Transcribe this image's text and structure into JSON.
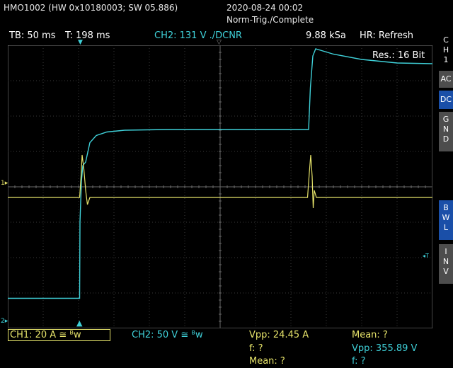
{
  "header": {
    "device": "HMO1002 (HW 0x10180003; SW 05.886)",
    "datetime": "2020-08-24 00:02",
    "mode": "Norm-Trig./Complete"
  },
  "status_bar": {
    "timebase": "TB: 50 ms",
    "trigger_time": "T: 198 ms",
    "trigger_source": "CH2: 131 V ./DCNR",
    "sample_rate": "9.88 kSa",
    "acq_mode": "HR: Refresh",
    "resolution": "Res.: 16 Bit"
  },
  "side_panel": {
    "channel": [
      "C",
      "H",
      "1"
    ],
    "ac": "AC",
    "dc": "DC",
    "gnd": [
      "G",
      "N",
      "D"
    ],
    "bwl": [
      "B",
      "W",
      "L"
    ],
    "inv": [
      "I",
      "N",
      "V"
    ]
  },
  "markers": {
    "ch1_level": "1",
    "ch2_level": "2",
    "trigger_level": "T"
  },
  "footer": {
    "ch1_scale": "CH1: 20 A ≅ ᴮw",
    "ch2_scale": "CH2: 50 V ≅ ᴮw",
    "ch1_vpp": "Vpp: 24.45 A",
    "ch1_f": "f: ?",
    "ch1_mean": "Mean: ?",
    "ch2_mean": "Mean: ?",
    "ch2_vpp": "Vpp: 355.89 V",
    "ch2_f": "f: ?"
  },
  "colors": {
    "ch1": "#e6e36a",
    "ch2": "#3fd1d9",
    "grid": "#3a3a3a",
    "panel_active": "#1a4fa8",
    "panel_inactive": "#4d4d4d"
  },
  "chart_data": {
    "type": "line",
    "grid": true,
    "x_divisions": 12,
    "y_divisions": 8,
    "series": [
      {
        "name": "CH1",
        "color": "#e6e36a",
        "points": [
          [
            0,
            -0.3
          ],
          [
            2.03,
            -0.3
          ],
          [
            2.07,
            0.3
          ],
          [
            2.1,
            0.9
          ],
          [
            2.15,
            0.5
          ],
          [
            2.2,
            -0.1
          ],
          [
            2.25,
            -0.5
          ],
          [
            2.32,
            -0.3
          ],
          [
            8.47,
            -0.3
          ],
          [
            8.52,
            0.4
          ],
          [
            8.56,
            0.9
          ],
          [
            8.6,
            0.3
          ],
          [
            8.63,
            -0.6
          ],
          [
            8.66,
            -0.1
          ],
          [
            8.72,
            -0.3
          ],
          [
            12,
            -0.3
          ]
        ]
      },
      {
        "name": "CH2",
        "color": "#3fd1d9",
        "points": [
          [
            0,
            -3.15
          ],
          [
            2.03,
            -3.15
          ],
          [
            2.04,
            -1.0
          ],
          [
            2.08,
            0.15
          ],
          [
            2.12,
            0.6
          ],
          [
            2.2,
            0.7
          ],
          [
            2.32,
            1.25
          ],
          [
            2.5,
            1.45
          ],
          [
            2.8,
            1.55
          ],
          [
            3.3,
            1.6
          ],
          [
            4.5,
            1.62
          ],
          [
            8.5,
            1.62
          ],
          [
            8.55,
            2.8
          ],
          [
            8.62,
            3.7
          ],
          [
            8.7,
            3.9
          ],
          [
            9.2,
            3.75
          ],
          [
            10.0,
            3.6
          ],
          [
            11.0,
            3.5
          ],
          [
            12.0,
            3.48
          ]
        ]
      }
    ]
  }
}
